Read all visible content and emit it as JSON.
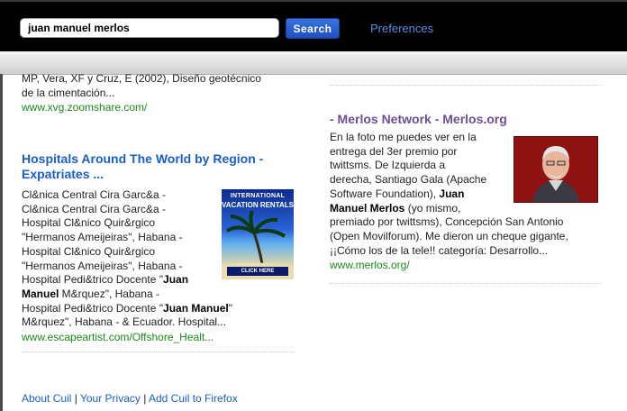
{
  "header": {
    "search_value": "juan manuel merlos",
    "search_button": "Search",
    "preferences": "Preferences"
  },
  "left_results": [
    {
      "snippet_lines": [
        "MP, Vera, XF y Cruz, E (2002), Diseño geotécnico",
        "de la cimentación..."
      ],
      "url": "www.xvg.zoomshare.com/"
    },
    {
      "title_line1": "Hospitals Around The World by Region -",
      "title_line2": "Expatriates ...",
      "snippet_lines": [
        "Cl&nica Central Cira Garc&a -",
        "Cl&nica Central Cira Garc&a -",
        "Hospital Cl&nico Quir&rgico",
        "\"Hermanos Ameijeiras\", Habana -",
        "Hospital Cl&nico Quir&rgico",
        "\"Hermanos Ameijeiras\", Habana -"
      ],
      "snippet_line7_pre": "Hospital Pedi&trico Docente \"",
      "snippet_line7_bold": "Juan",
      "snippet_line8_bold": "Manuel",
      "snippet_line8_post": " M&rquez\", Habana -",
      "snippet_line9_pre": "Hospital Pedi&trico Docente \"",
      "snippet_line9_bold": "Juan Manuel",
      "snippet_line10": "M&rquez\", Habana - & Ecuador. Hospital...",
      "url": "www.escapeartist.com/Offshore_Healt...",
      "thumb": {
        "line1": "INTERNATIONAL",
        "line2": "VACATION RENTALS",
        "cta": "CLICK HERE"
      }
    }
  ],
  "right_results": [
    {
      "title": "- Merlos Network - Merlos.org",
      "snippet_lines": [
        "En la foto me puedes ver en la",
        "entrega del 3er premio por",
        "twittsms. De Izquierda a",
        "derecha, Santiago Gala (Apache",
        "Software Foundation), "
      ],
      "bold1": "Juan",
      "bold2": "Manuel Merlos",
      "after_bold2": " (yo mismo,",
      "snippet_rest": [
        "premiado por twittsms), Concepción San Antonio",
        "(Open Movilforum). Me dieron un cheque gigante,",
        "¡¡Cómo los de la tele!! categoría: Desarrollo..."
      ],
      "url": "www.merlos.org/"
    }
  ],
  "footer": {
    "about": "About Cuil",
    "sep": " | ",
    "privacy": "Your Privacy",
    "firefox": "Add Cuil to Firefox"
  },
  "colors": {
    "link": "#1a5fc8",
    "url_green": "#1a8a1a",
    "visited_title": "#6e4c9a"
  }
}
